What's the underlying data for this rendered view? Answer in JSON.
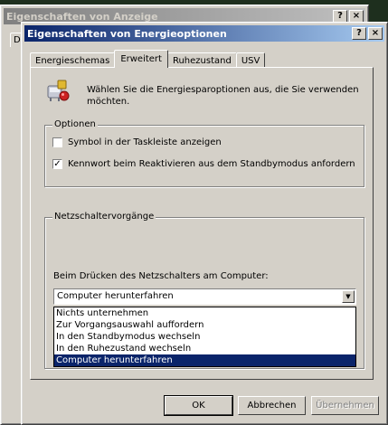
{
  "back_window": {
    "title": "Eigenschaften von Anzeige",
    "tab_fragment": "D"
  },
  "dialog": {
    "title": "Eigenschaften von Energieoptionen",
    "help_label": "?",
    "close_label": "×"
  },
  "tabs": [
    {
      "label": "Energieschemas"
    },
    {
      "label": "Erweitert"
    },
    {
      "label": "Ruhezustand"
    },
    {
      "label": "USV"
    }
  ],
  "intro_text_line1": "Wählen Sie die Energiesparoptionen aus, die Sie verwenden",
  "intro_text_line2": "möchten.",
  "options_group": {
    "legend": "Optionen",
    "tray_icon_label": "Symbol in der Taskleiste anzeigen",
    "tray_icon_checked": false,
    "password_label": "Kennwort beim Reaktivieren aus dem Standbymodus anfordern",
    "password_checked": true,
    "check_mark": "✓"
  },
  "power_buttons_group": {
    "legend": "Netzschaltervorgänge",
    "prompt": "Beim Drücken des Netzschalters am Computer:",
    "selected_value": "Computer herunterfahren",
    "arrow": "▼",
    "options": [
      "Nichts unternehmen",
      "Zur Vorgangsauswahl auffordern",
      "In den Standbymodus wechseln",
      "In den Ruhezustand wechseln",
      "Computer herunterfahren"
    ]
  },
  "buttons": {
    "ok": "OK",
    "cancel": "Abbrechen",
    "apply": "Übernehmen"
  },
  "colors": {
    "titlebar_active": "#0a246a",
    "titlebar_inactive": "#808080",
    "selection": "#0a246a",
    "face": "#d4d0c8"
  }
}
